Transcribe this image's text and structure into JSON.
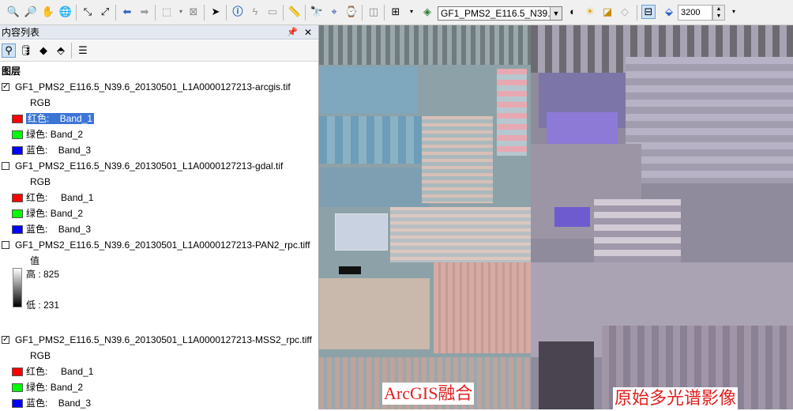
{
  "toolbar": {
    "layer_select": "GF1_PMS2_E116.5_N39.6",
    "zoom_value": "3200"
  },
  "toc": {
    "title": "内容列表",
    "section": "图层",
    "layers": [
      {
        "name": "GF1_PMS2_E116.5_N39.6_20130501_L1A0000127213-arcgis.tif",
        "checked": true,
        "mode": "RGB",
        "bands": [
          {
            "label": "红色:",
            "band": "Band_1"
          },
          {
            "label": "绿色:",
            "band": "Band_2"
          },
          {
            "label": "蓝色:",
            "band": "Band_3"
          }
        ]
      },
      {
        "name": "GF1_PMS2_E116.5_N39.6_20130501_L1A0000127213-gdal.tif",
        "checked": false,
        "mode": "RGB",
        "bands": [
          {
            "label": "红色:",
            "band": "Band_1"
          },
          {
            "label": "绿色:",
            "band": "Band_2"
          },
          {
            "label": "蓝色:",
            "band": "Band_3"
          }
        ]
      },
      {
        "name": "GF1_PMS2_E116.5_N39.6_20130501_L1A0000127213-PAN2_rpc.tiff",
        "checked": false,
        "mode": "值",
        "high": "高 : 825",
        "low": "低 : 231"
      },
      {
        "name": "GF1_PMS2_E116.5_N39.6_20130501_L1A0000127213-MSS2_rpc.tiff",
        "checked": true,
        "mode": "RGB",
        "bands": [
          {
            "label": "红色:",
            "band": "Band_1"
          },
          {
            "label": "绿色:",
            "band": "Band_2"
          },
          {
            "label": "蓝色:",
            "band": "Band_3"
          }
        ]
      }
    ]
  },
  "map": {
    "left_caption": "ArcGIS融合",
    "right_caption": "原始多光谱影像"
  },
  "colors": {
    "red": "#ff0000",
    "green": "#00ff00",
    "blue": "#0000ff",
    "selection": "#3c75d6"
  }
}
